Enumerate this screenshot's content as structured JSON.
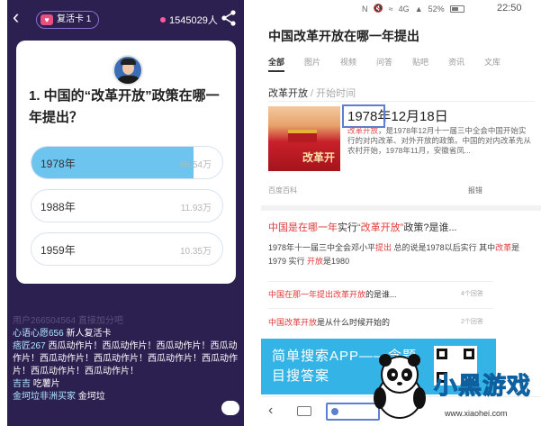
{
  "left": {
    "back_icon": "chevron-left-icon",
    "revive_label": "复活卡 1",
    "online_count": "1545029人",
    "share_icon": "share-icon",
    "question": "1. 中国的“改革开放”政策在哪一年提出？",
    "options": [
      {
        "label": "1978年",
        "count": "86.54万",
        "share": 0.85,
        "selected": true
      },
      {
        "label": "1988年",
        "count": "11.93万",
        "share": 0.0,
        "selected": false
      },
      {
        "label": "1959年",
        "count": "10.35万",
        "share": 0.0,
        "selected": false
      }
    ],
    "feed": {
      "faded": "用户266504564 直接加分吧",
      "line1_nick": "心语心愿656",
      "line1_text": " 新人复活卡",
      "line2_nick": "痞匠267",
      "line2_text": " 西瓜动作片！西瓜动作片！西瓜动作片！西瓜动作片！西瓜动作片！西瓜动作片！西瓜动作片！西瓜动作片！西瓜动作片！西瓜动作片！",
      "line3_nick": "吉吉",
      "line3_text": " 吃薯片",
      "line4_nick": "金坷垃非洲买家",
      "line4_text": " 金坷垃"
    },
    "chat_icon": "chat-bubble-icon"
  },
  "right": {
    "status": {
      "signal": "4G",
      "battery": "52%",
      "time": "22:50"
    },
    "query": "中国改革开放在哪一年提出",
    "tabs": [
      "全部",
      "图片",
      "视频",
      "问答",
      "贴吧",
      "资讯",
      "文库"
    ],
    "breadcrumb_main": "改革开放",
    "breadcrumb_sub": " / 开始时间",
    "answer_title": "1978年12月18日",
    "answer_desc_hl": "改革开放",
    "answer_desc": "，是1978年12月十一届三中全会中国开始实行的对内改革、对外开放的政策。中国的对内改革先从农村开始，1978年11月，安徽省凤...",
    "thumb_caption": "改革开",
    "source": "百度百科",
    "report": "报错",
    "result2_title_a": "中国是在哪一年",
    "result2_title_b": "实行",
    "result2_title_c": "“改革开放”",
    "result2_title_d": "政策?是谁...",
    "result2_body_a": "1978年十一届三中全会邓小平",
    "result2_body_b": "提出",
    "result2_body_c": " 总的说是1978以后实行 其中",
    "result2_body_d": "改革",
    "result2_body_e": "是1979 实行 ",
    "result2_body_f": "开放",
    "result2_body_g": "是1980",
    "result3_a": "中国在那一年提出改革开放",
    "result3_b": "的是谁...",
    "result3_count": "4个回答",
    "result4_a": "中国改革开放",
    "result4_b": "是从什么时候开始的",
    "result4_count": "2个回答",
    "banner": "简单搜索APP——念题目搜答案",
    "nav_back_icon": "chevron-left-icon",
    "keyboard_icon": "keyboard-icon",
    "mic_icon": "voice-search-icon"
  },
  "watermark": {
    "word": "小黑游戏",
    "url": "www.xiaohei.com"
  }
}
